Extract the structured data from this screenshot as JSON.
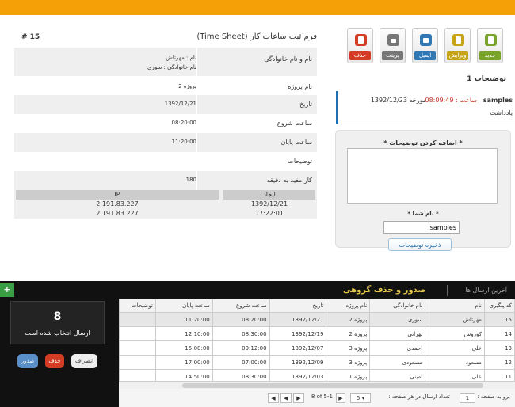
{
  "toolbar": {
    "new": "جدید",
    "edit": "ویرایش",
    "email": "ایمیل",
    "print": "پرینت",
    "delete": "حذف"
  },
  "notes": {
    "title": "توضیحات 1",
    "item": {
      "user": "samples",
      "time": "ساعت : 08:09:49",
      "date": "مورخه 1392/12/23",
      "body": "یادداشت"
    },
    "add_label": "* اضافه کردن توضیحات *",
    "name_label": "* نام شما *",
    "name_value": "samples",
    "save": "ذخیره توضیحات"
  },
  "form": {
    "title": "فرم ثبت ساعات کار (Time Sheet)",
    "number": "# 15",
    "name_key": "نام و نام خانوادگی",
    "name_val1": "نام : مهرتاش",
    "name_val2": "نام خانوادگی : سوری",
    "rows": [
      {
        "k": "نام پروژه",
        "v": "پروژه 2"
      },
      {
        "k": "تاریخ",
        "v": "1392/12/21"
      },
      {
        "k": "ساعت شروع",
        "v": "08:20:00"
      },
      {
        "k": "ساعت پایان",
        "v": "11:20:00"
      },
      {
        "k": "توضیحات",
        "v": ""
      },
      {
        "k": "کار مفید به دقیقه",
        "v": "180"
      }
    ],
    "created_h": "ایجاد",
    "ip_h": "IP",
    "created_1": "1392/12/21",
    "created_2": "17:22:01",
    "ip_1": "2.191.83.227",
    "ip_2": "2.191.83.227"
  },
  "bottom": {
    "title": "صدور و حذف گروهی",
    "recent": "آخرین ارسال ها",
    "selected_count": "8",
    "selected_text": "ارسال انتخاب شده است",
    "cancel": "انصراف",
    "delete": "حذف",
    "issue": "صدور"
  },
  "grid": {
    "headers": [
      "کد پیگیری",
      "نام",
      "نام خانوادگی",
      "نام پروژه",
      "تاریخ",
      "ساعت شروع",
      "ساعت پایان",
      "توضیحات"
    ],
    "rows": [
      [
        "15",
        "مهرتاش",
        "سوری",
        "پروژه 2",
        "1392/12/21",
        "08:20:00",
        "11:20:00",
        ""
      ],
      [
        "14",
        "کوروش",
        "تهرانی",
        "پروژه 2",
        "1392/12/19",
        "08:30:00",
        "12:10:00",
        ""
      ],
      [
        "13",
        "علی",
        "احمدی",
        "پروژه 3",
        "1392/12/07",
        "09:12:00",
        "15:00:00",
        ""
      ],
      [
        "12",
        "مسعود",
        "مسعودی",
        "پروژه 3",
        "1392/12/09",
        "07:00:00",
        "17:00:00",
        ""
      ],
      [
        "11",
        "علی",
        "امینی",
        "پروژه 1",
        "1392/12/03",
        "08:30:00",
        "14:50:00",
        ""
      ]
    ]
  },
  "pager": {
    "goto_label": "برو به صفحه :",
    "goto_value": "1",
    "perpage_label": "تعداد ارسال در هر صفحه :",
    "perpage_value": "5",
    "range": "8 of 5-1"
  }
}
